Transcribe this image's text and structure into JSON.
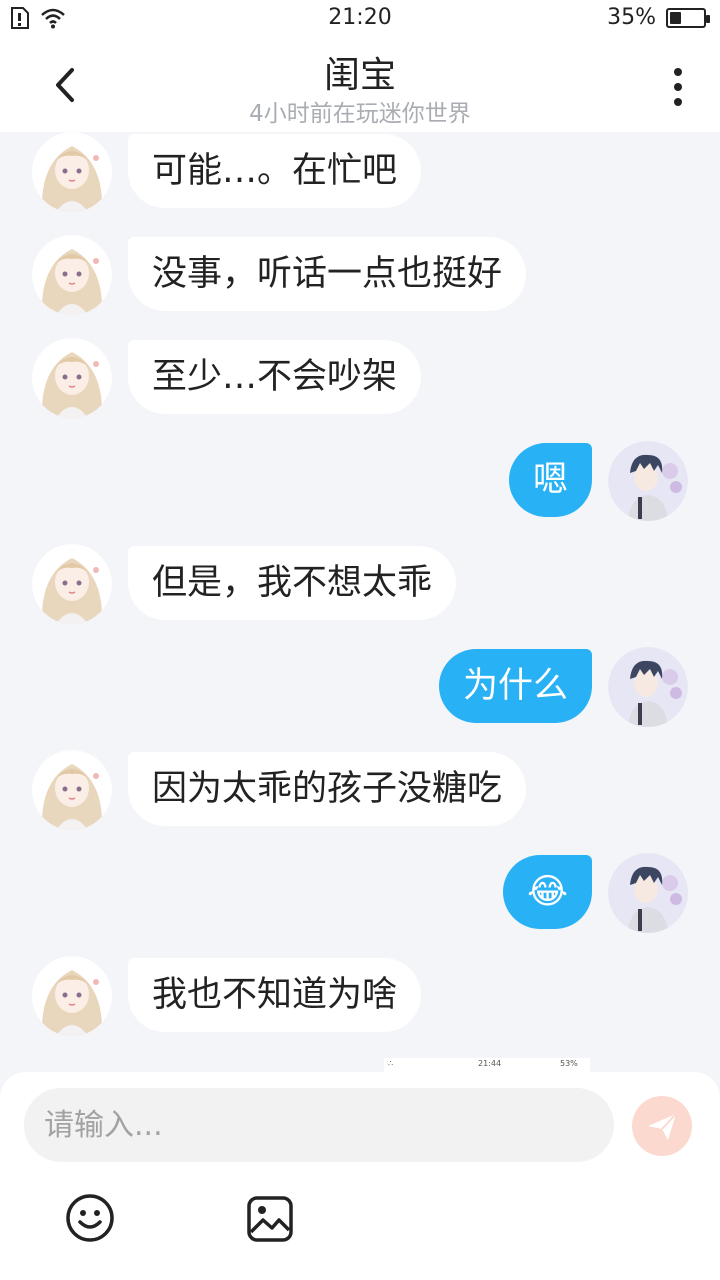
{
  "status_bar": {
    "time": "21:20",
    "battery": "35%",
    "battery_level": 0.35
  },
  "header": {
    "title": "闺宝",
    "subtitle": "4小时前在玩迷你世界"
  },
  "messages": [
    {
      "side": "in",
      "text": "可能…。在忙吧"
    },
    {
      "side": "in",
      "text": "没事，听话一点也挺好"
    },
    {
      "side": "in",
      "text": "至少…不会吵架"
    },
    {
      "side": "out",
      "text": "嗯"
    },
    {
      "side": "in",
      "text": "但是，我不想太乖"
    },
    {
      "side": "out",
      "text": "为什么"
    },
    {
      "side": "in",
      "text": "因为太乖的孩子没糖吃"
    },
    {
      "side": "out",
      "text": "😂"
    },
    {
      "side": "in",
      "text": "我也不知道为啥"
    }
  ],
  "screenshot_peek": {
    "time": "21:44",
    "battery": "53%"
  },
  "composer": {
    "placeholder": "请输入..."
  },
  "colors": {
    "outgoing_bubble": "#29b1f5",
    "incoming_bubble": "#ffffff",
    "background": "#f3f5f8"
  }
}
